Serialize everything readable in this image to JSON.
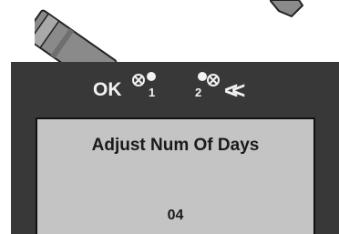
{
  "device": {
    "buttons": {
      "ok_label": "OK",
      "button1_label": "1",
      "button2_label": "2",
      "back_label": "<<"
    },
    "screen": {
      "title": "Adjust Num Of Days",
      "value": "04"
    }
  },
  "colors": {
    "device_body": "#383838",
    "screen_bg": "#c4c4c4",
    "text_light": "#f2f2f2",
    "text_dark": "#1a1a1a"
  },
  "icons": [
    "probe-left-icon",
    "probe-right-icon",
    "led-indicator-icon"
  ]
}
